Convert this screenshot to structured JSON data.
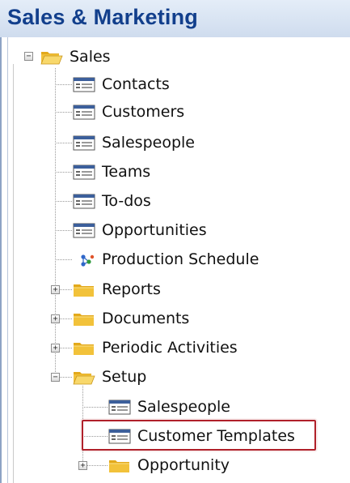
{
  "header": {
    "title": "Sales & Marketing"
  },
  "tree": {
    "root": {
      "label": "Sales",
      "icon": "folder-open-icon",
      "expanded": true,
      "children": [
        {
          "label": "Contacts",
          "icon": "form-icon"
        },
        {
          "label": "Customers",
          "icon": "form-icon"
        },
        {
          "label": "Salespeople",
          "icon": "form-icon"
        },
        {
          "label": "Teams",
          "icon": "form-icon"
        },
        {
          "label": "To-dos",
          "icon": "form-icon"
        },
        {
          "label": "Opportunities",
          "icon": "form-icon"
        },
        {
          "label": "Production Schedule",
          "icon": "schedule-icon"
        },
        {
          "label": "Reports",
          "icon": "folder-closed-icon",
          "expanded": false
        },
        {
          "label": "Documents",
          "icon": "folder-closed-icon",
          "expanded": false
        },
        {
          "label": "Periodic Activities",
          "icon": "folder-closed-icon",
          "expanded": false
        },
        {
          "label": "Setup",
          "icon": "folder-open-icon",
          "expanded": true,
          "children": [
            {
              "label": "Salespeople",
              "icon": "form-icon"
            },
            {
              "label": "Customer Templates",
              "icon": "form-icon",
              "highlighted": true
            },
            {
              "label": "Opportunity",
              "icon": "folder-closed-icon",
              "expanded": false
            }
          ]
        }
      ]
    }
  },
  "colors": {
    "header_text": "#123f8c",
    "header_bg": "#cfdcee",
    "folder": "#f2c23a",
    "highlight_border": "#b0202a"
  }
}
